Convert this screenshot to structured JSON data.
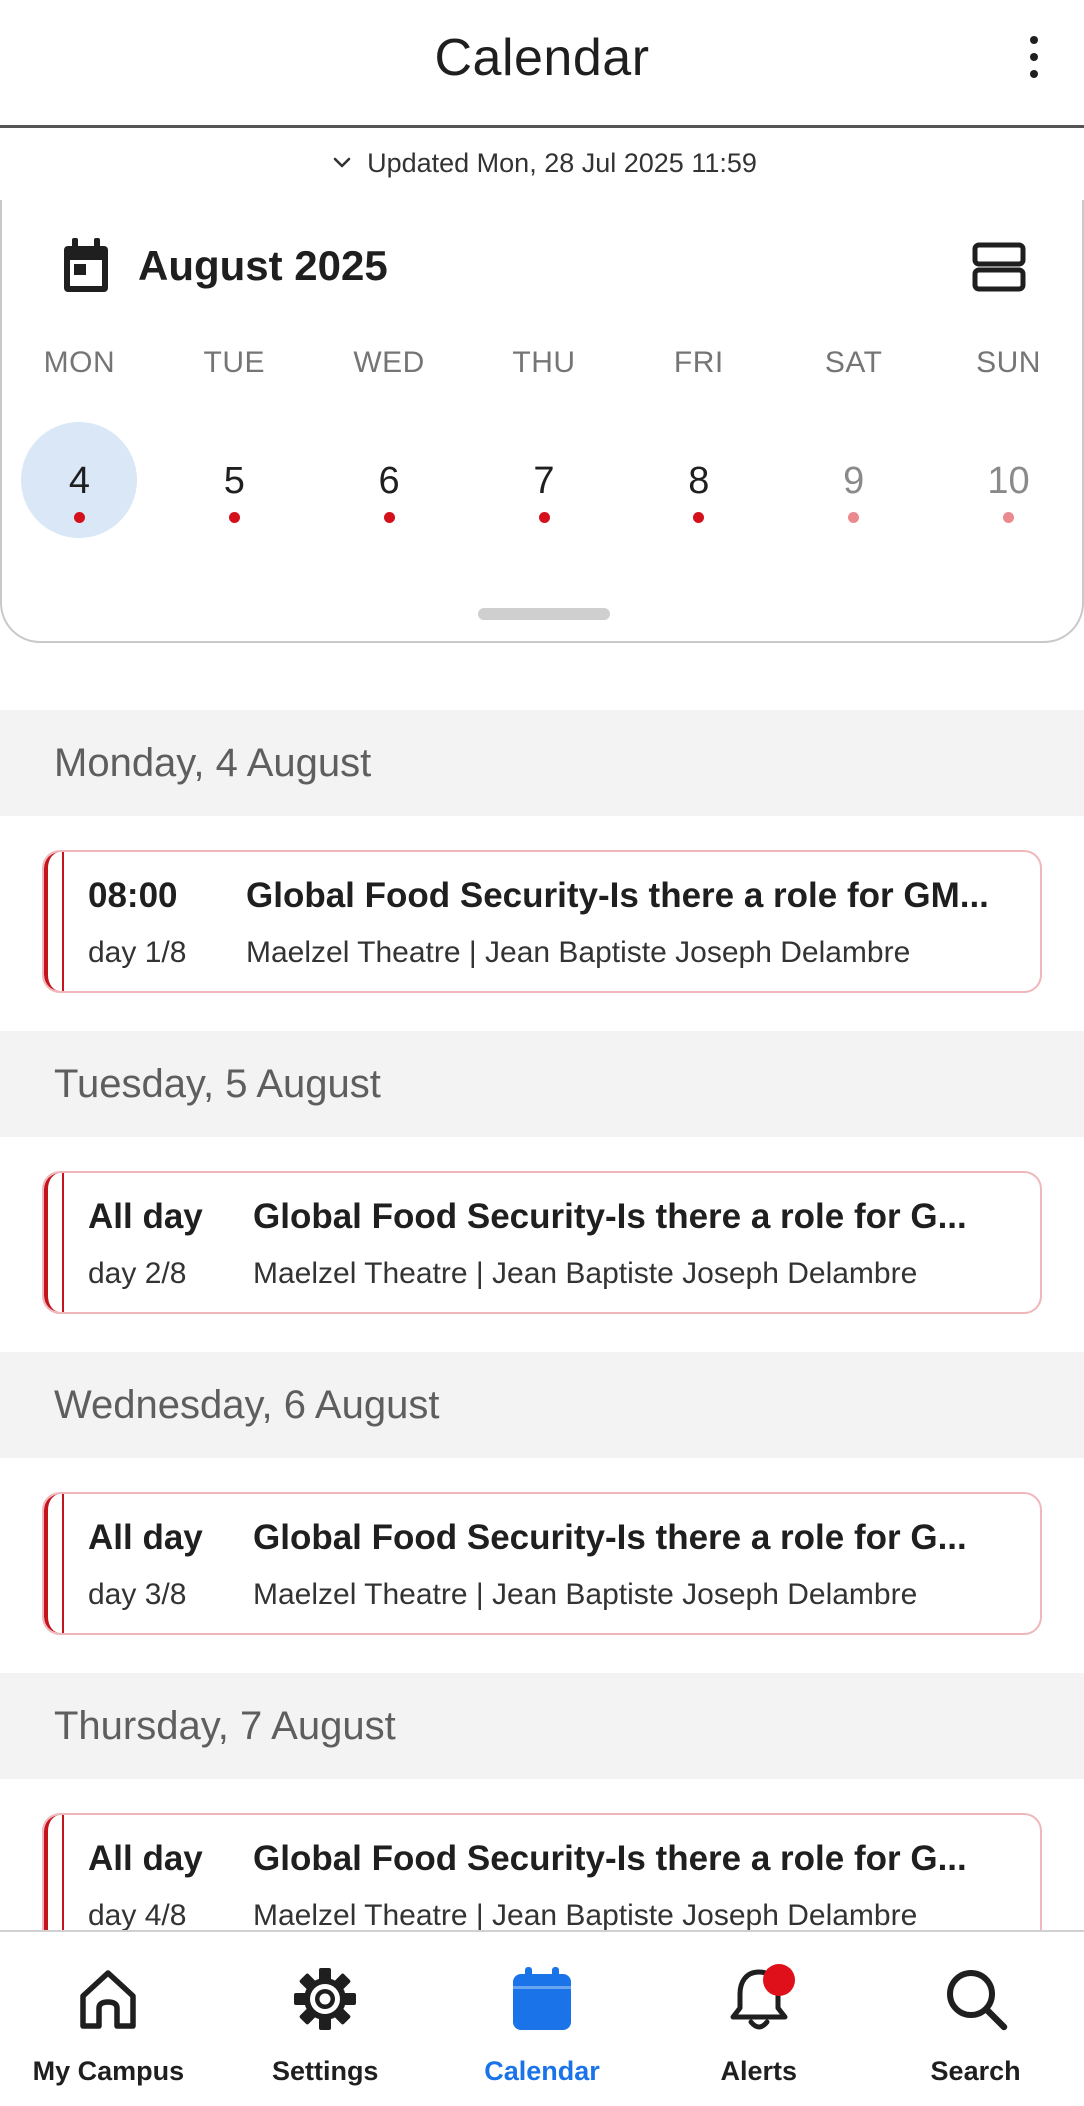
{
  "app_bar": {
    "title": "Calendar",
    "more_icon": "more-vertical-icon"
  },
  "updated": {
    "icon": "chevron-down-icon",
    "text": "Updated Mon, 28 Jul 2025 11:59"
  },
  "calendar": {
    "icon": "calendar-icon",
    "month_label": "August 2025",
    "view_toggle_icon": "view-agenda-icon",
    "weekday_headers": [
      "MON",
      "TUE",
      "WED",
      "THU",
      "FRI",
      "SAT",
      "SUN"
    ],
    "days": [
      {
        "number": "4",
        "selected": true,
        "weekend": false,
        "has_event": true
      },
      {
        "number": "5",
        "selected": false,
        "weekend": false,
        "has_event": true
      },
      {
        "number": "6",
        "selected": false,
        "weekend": false,
        "has_event": true
      },
      {
        "number": "7",
        "selected": false,
        "weekend": false,
        "has_event": true
      },
      {
        "number": "8",
        "selected": false,
        "weekend": false,
        "has_event": true
      },
      {
        "number": "9",
        "selected": false,
        "weekend": true,
        "has_event": true
      },
      {
        "number": "10",
        "selected": false,
        "weekend": true,
        "has_event": true
      }
    ],
    "selected_color": "#d9e7f6",
    "event_dot_color": "#d4101b"
  },
  "agenda": {
    "sections": [
      {
        "header": "Monday, 4 August",
        "event": {
          "time": "08:00",
          "day_count": "day 1/8",
          "title": "Global Food Security-Is there a role for GM...",
          "location": "Maelzel Theatre | Jean Baptiste Joseph Delambre"
        }
      },
      {
        "header": "Tuesday, 5 August",
        "event": {
          "time": "All day",
          "day_count": "day 2/8",
          "title": "Global Food Security-Is there a role for G...",
          "location": "Maelzel Theatre | Jean Baptiste Joseph Delambre"
        }
      },
      {
        "header": "Wednesday, 6 August",
        "event": {
          "time": "All day",
          "day_count": "day 3/8",
          "title": "Global Food Security-Is there a role for G...",
          "location": "Maelzel Theatre | Jean Baptiste Joseph Delambre"
        }
      },
      {
        "header": "Thursday, 7 August",
        "event": {
          "time": "All day",
          "day_count": "day 4/8",
          "title": "Global Food Security-Is there a role for G...",
          "location": "Maelzel Theatre | Jean Baptiste Joseph Delambre"
        }
      }
    ],
    "event_accent_color": "#c5141e"
  },
  "bottom_nav": {
    "items": [
      {
        "label": "My Campus",
        "icon": "home-icon",
        "active": false
      },
      {
        "label": "Settings",
        "icon": "gear-icon",
        "active": false
      },
      {
        "label": "Calendar",
        "icon": "calendar-icon",
        "active": true
      },
      {
        "label": "Alerts",
        "icon": "bell-icon",
        "active": false,
        "badge": true
      },
      {
        "label": "Search",
        "icon": "search-icon",
        "active": false
      }
    ],
    "active_color": "#1a73e8",
    "badge_color": "#e0101b"
  }
}
